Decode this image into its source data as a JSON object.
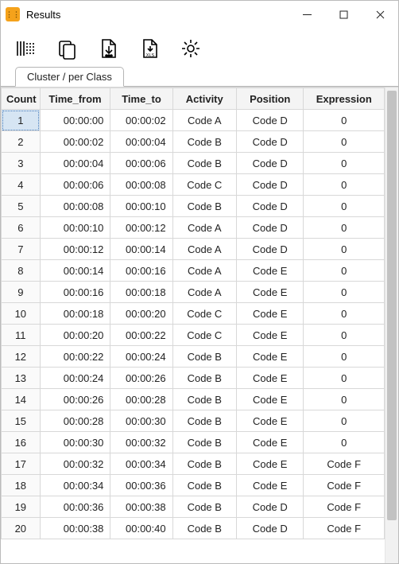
{
  "window": {
    "title": "Results"
  },
  "tabs": {
    "active": "Cluster / per Class"
  },
  "columns": [
    "Count",
    "Time_from",
    "Time_to",
    "Activity",
    "Position",
    "Expression"
  ],
  "selected_cell": {
    "row": 0,
    "col": 0
  },
  "rows": [
    {
      "count": "1",
      "time_from": "00:00:00",
      "time_to": "00:00:02",
      "activity": "Code A",
      "position": "Code D",
      "expression": "0"
    },
    {
      "count": "2",
      "time_from": "00:00:02",
      "time_to": "00:00:04",
      "activity": "Code B",
      "position": "Code D",
      "expression": "0"
    },
    {
      "count": "3",
      "time_from": "00:00:04",
      "time_to": "00:00:06",
      "activity": "Code B",
      "position": "Code D",
      "expression": "0"
    },
    {
      "count": "4",
      "time_from": "00:00:06",
      "time_to": "00:00:08",
      "activity": "Code C",
      "position": "Code D",
      "expression": "0"
    },
    {
      "count": "5",
      "time_from": "00:00:08",
      "time_to": "00:00:10",
      "activity": "Code B",
      "position": "Code D",
      "expression": "0"
    },
    {
      "count": "6",
      "time_from": "00:00:10",
      "time_to": "00:00:12",
      "activity": "Code A",
      "position": "Code D",
      "expression": "0"
    },
    {
      "count": "7",
      "time_from": "00:00:12",
      "time_to": "00:00:14",
      "activity": "Code A",
      "position": "Code D",
      "expression": "0"
    },
    {
      "count": "8",
      "time_from": "00:00:14",
      "time_to": "00:00:16",
      "activity": "Code A",
      "position": "Code E",
      "expression": "0"
    },
    {
      "count": "9",
      "time_from": "00:00:16",
      "time_to": "00:00:18",
      "activity": "Code A",
      "position": "Code E",
      "expression": "0"
    },
    {
      "count": "10",
      "time_from": "00:00:18",
      "time_to": "00:00:20",
      "activity": "Code C",
      "position": "Code E",
      "expression": "0"
    },
    {
      "count": "11",
      "time_from": "00:00:20",
      "time_to": "00:00:22",
      "activity": "Code C",
      "position": "Code E",
      "expression": "0"
    },
    {
      "count": "12",
      "time_from": "00:00:22",
      "time_to": "00:00:24",
      "activity": "Code B",
      "position": "Code E",
      "expression": "0"
    },
    {
      "count": "13",
      "time_from": "00:00:24",
      "time_to": "00:00:26",
      "activity": "Code B",
      "position": "Code E",
      "expression": "0"
    },
    {
      "count": "14",
      "time_from": "00:00:26",
      "time_to": "00:00:28",
      "activity": "Code B",
      "position": "Code E",
      "expression": "0"
    },
    {
      "count": "15",
      "time_from": "00:00:28",
      "time_to": "00:00:30",
      "activity": "Code B",
      "position": "Code E",
      "expression": "0"
    },
    {
      "count": "16",
      "time_from": "00:00:30",
      "time_to": "00:00:32",
      "activity": "Code B",
      "position": "Code E",
      "expression": "0"
    },
    {
      "count": "17",
      "time_from": "00:00:32",
      "time_to": "00:00:34",
      "activity": "Code B",
      "position": "Code E",
      "expression": "Code F"
    },
    {
      "count": "18",
      "time_from": "00:00:34",
      "time_to": "00:00:36",
      "activity": "Code B",
      "position": "Code E",
      "expression": "Code F"
    },
    {
      "count": "19",
      "time_from": "00:00:36",
      "time_to": "00:00:38",
      "activity": "Code B",
      "position": "Code D",
      "expression": "Code F"
    },
    {
      "count": "20",
      "time_from": "00:00:38",
      "time_to": "00:00:40",
      "activity": "Code B",
      "position": "Code D",
      "expression": "Code F"
    }
  ],
  "toolbar": {
    "icons": [
      "columns-icon",
      "copy-icon",
      "download-icon",
      "export-xls-icon",
      "gear-icon"
    ]
  }
}
